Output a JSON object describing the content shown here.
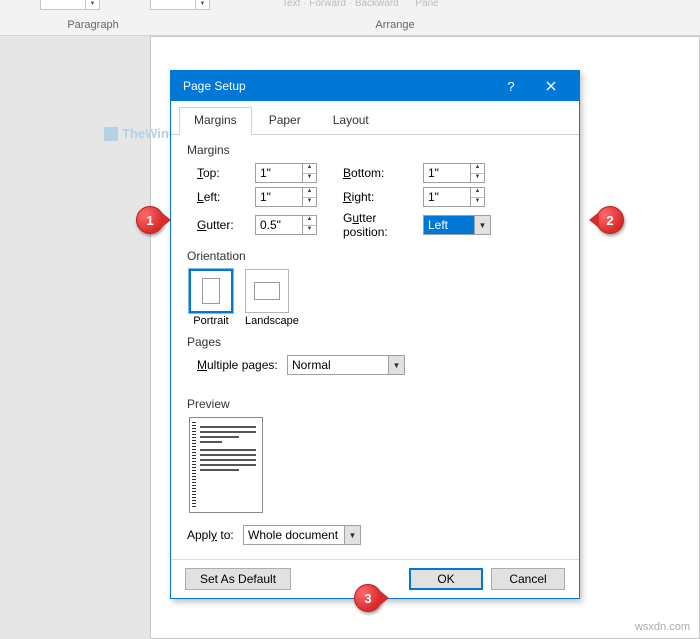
{
  "ribbon": {
    "paragraph_label": "Paragraph",
    "arrange_label": "Arrange",
    "text_label": "Text",
    "forward_label": "Forward",
    "backward_label": "Backward",
    "pane_label": "Pane"
  },
  "watermark": "TheWindowsClub",
  "dialog": {
    "title": "Page Setup",
    "tabs": {
      "margins": "Margins",
      "paper": "Paper",
      "layout": "Layout"
    },
    "margins": {
      "section": "Margins",
      "top_label": "Top:",
      "top_value": "1\"",
      "bottom_label": "Bottom:",
      "bottom_value": "1\"",
      "left_label": "Left:",
      "left_value": "1\"",
      "right_label": "Right:",
      "right_value": "1\"",
      "gutter_label": "Gutter:",
      "gutter_value": "0.5\"",
      "gutter_pos_label": "Gutter position:",
      "gutter_pos_value": "Left"
    },
    "orientation": {
      "section": "Orientation",
      "portrait": "Portrait",
      "landscape": "Landscape"
    },
    "pages": {
      "section": "Pages",
      "multiple_label": "Multiple pages:",
      "multiple_value": "Normal"
    },
    "preview": {
      "section": "Preview"
    },
    "apply": {
      "label": "Apply to:",
      "value": "Whole document"
    },
    "buttons": {
      "default": "Set As Default",
      "ok": "OK",
      "cancel": "Cancel"
    }
  },
  "callouts": {
    "one": "1",
    "two": "2",
    "three": "3"
  },
  "credit": "wsxdn.com"
}
